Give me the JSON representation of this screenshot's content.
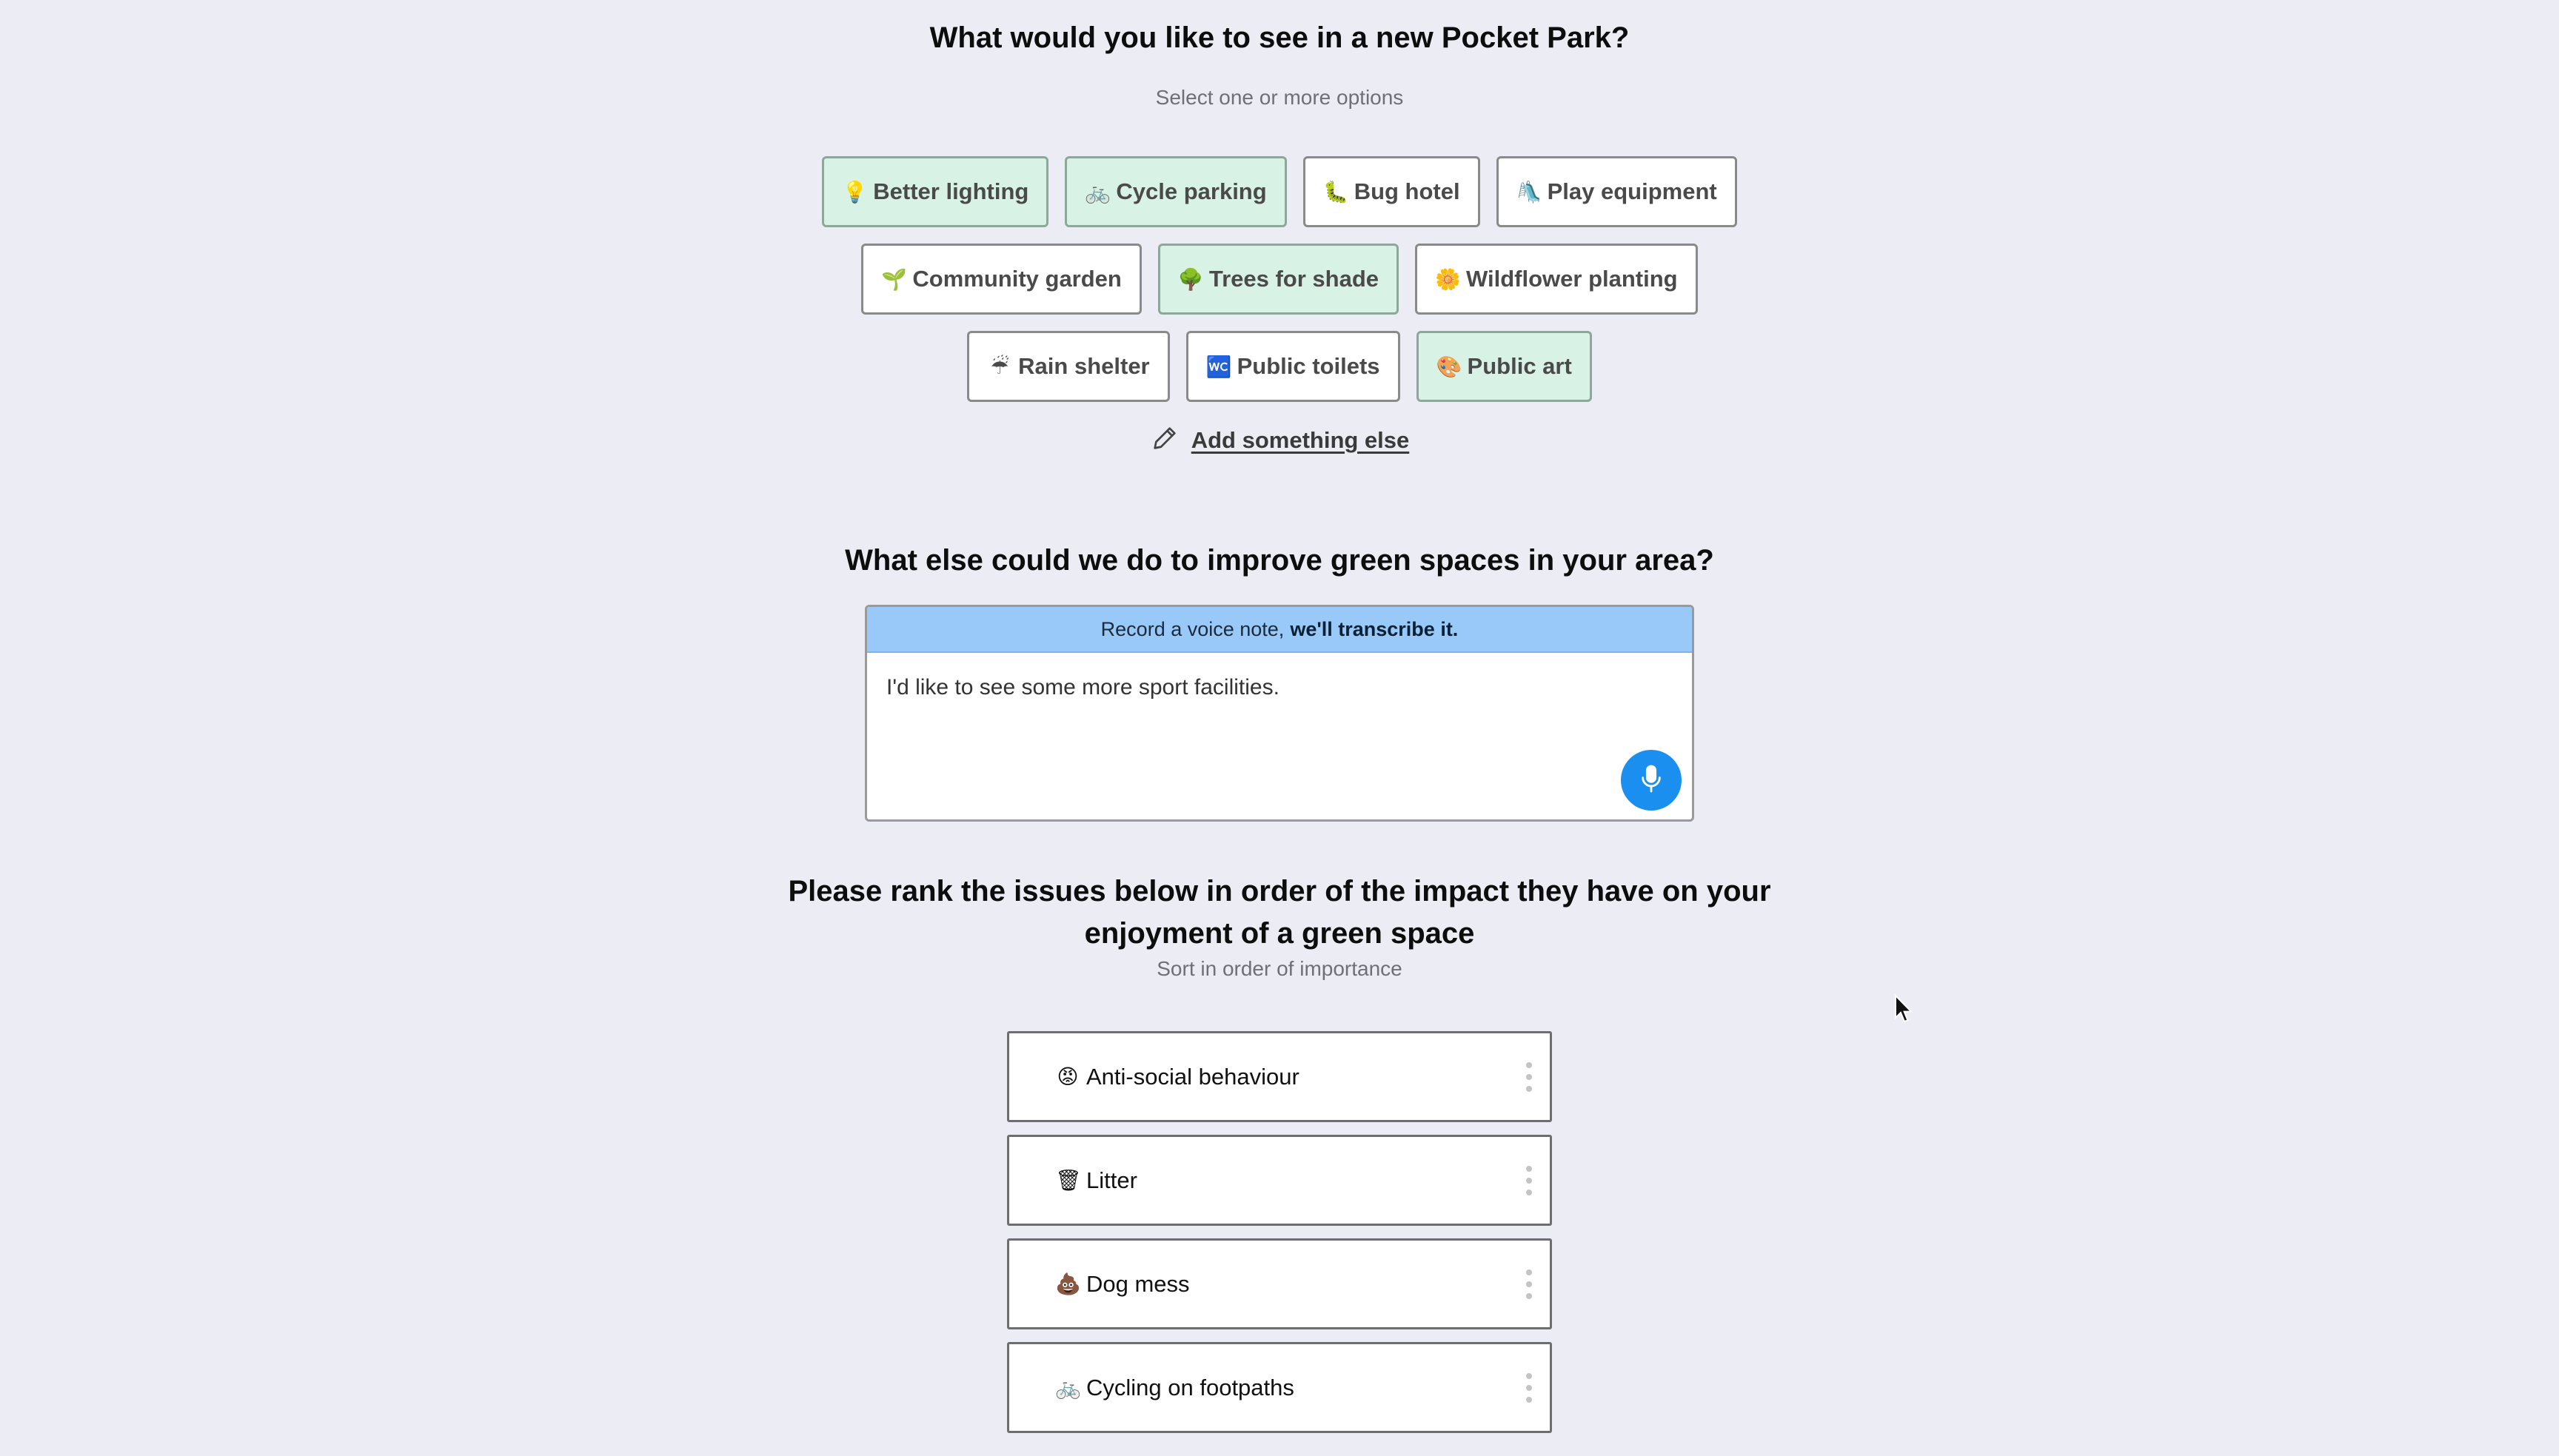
{
  "q1": {
    "title": "What would you like to see in a new Pocket Park?",
    "subtitle": "Select one or more options",
    "options_row1": [
      {
        "emoji": "💡",
        "label": "Better lighting",
        "selected": true
      },
      {
        "emoji": "🚲",
        "label": "Cycle parking",
        "selected": true
      },
      {
        "emoji": "🐛",
        "label": "Bug hotel",
        "selected": false
      },
      {
        "emoji": "🛝",
        "label": "Play equipment",
        "selected": false
      }
    ],
    "options_row2": [
      {
        "emoji": "🌱",
        "label": "Community garden",
        "selected": false
      },
      {
        "emoji": "🌳",
        "label": "Trees for shade",
        "selected": true
      },
      {
        "emoji": "🌼",
        "label": "Wildflower planting",
        "selected": false
      }
    ],
    "options_row3": [
      {
        "emoji": "☔",
        "label": "Rain shelter",
        "selected": false
      },
      {
        "emoji": "🚾",
        "label": "Public toilets",
        "selected": false
      },
      {
        "emoji": "🎨",
        "label": "Public art",
        "selected": true
      }
    ],
    "add_else_label": "Add something else"
  },
  "q2": {
    "title": "What else could we do to improve green spaces in your area?",
    "banner_prefix": "Record a voice note,",
    "banner_bold": "we'll transcribe it.",
    "answer": "I'd like to see some more sport facilities."
  },
  "q3": {
    "title_line1": "Please rank the issues below in order of the impact they have on your",
    "title_line2": "enjoyment of a green space",
    "subtitle": "Sort in order of importance",
    "items": [
      {
        "emoji": "😡",
        "label": "Anti-social behaviour"
      },
      {
        "emoji": "🗑",
        "label": "Litter"
      },
      {
        "emoji": "💩",
        "label": "Dog mess"
      },
      {
        "emoji": "🚲",
        "label": "Cycling on footpaths"
      }
    ]
  },
  "colors": {
    "page_bg": "#ececf4",
    "chip_selected_bg": "#d9f2e6",
    "banner_bg": "#99c9f8",
    "mic_button": "#1a8ff0"
  }
}
